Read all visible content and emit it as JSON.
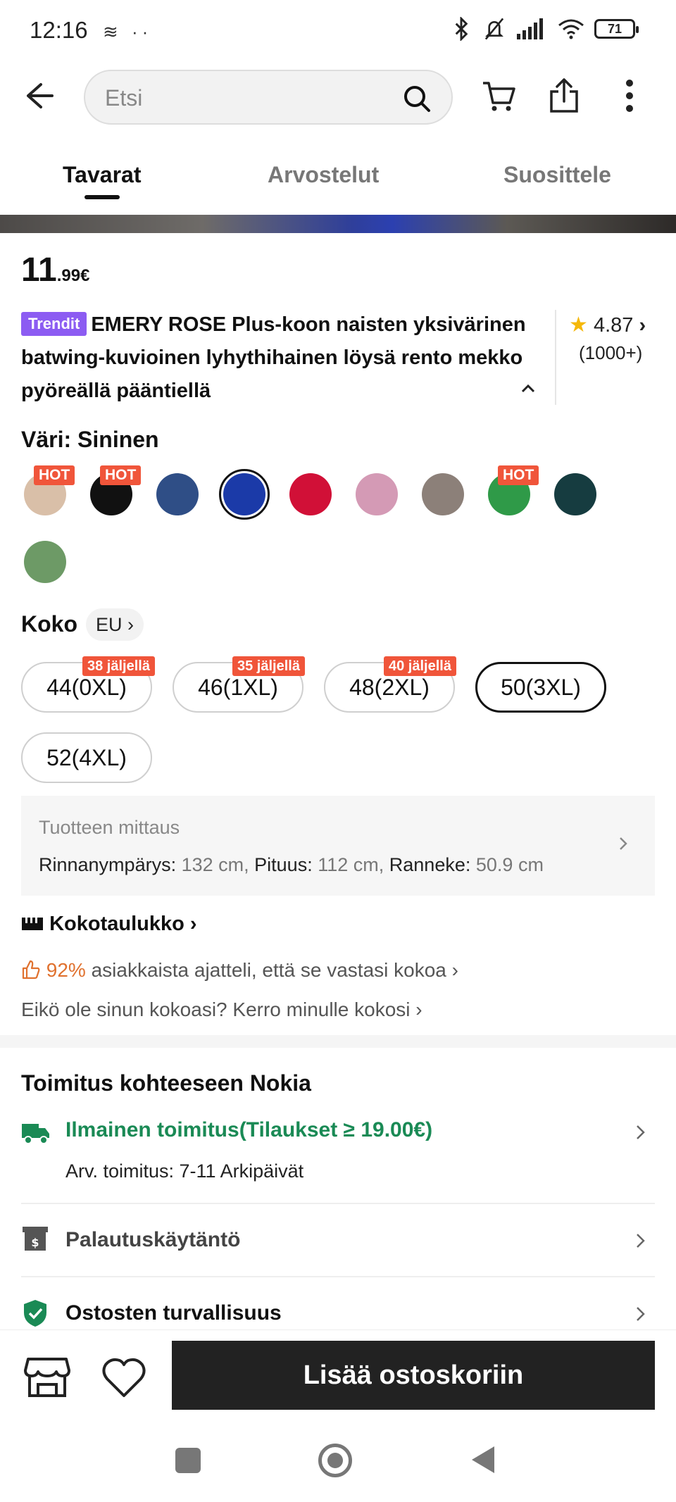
{
  "status_bar": {
    "time": "12:16",
    "left_icons": "≋ ··",
    "battery": "71"
  },
  "header": {
    "search_placeholder": "Etsi"
  },
  "tabs": [
    {
      "label": "Tavarat",
      "active": true
    },
    {
      "label": "Arvostelut",
      "active": false
    },
    {
      "label": "Suosittele",
      "active": false
    }
  ],
  "product": {
    "price_main": "11",
    "price_decimal": ".99€",
    "trend_tag": "Trendit",
    "title": "EMERY ROSE Plus-koon naisten yksivärinen batwing-kuvioinen lyhythihainen löysä rento mekko pyöreällä pääntiellä",
    "rating": "4.87",
    "rating_count": "(1000+)"
  },
  "color": {
    "label": "Väri: Sininen",
    "hot_label": "HOT",
    "swatches": [
      {
        "name": "beige",
        "color": "#d9bfa8",
        "hot": true
      },
      {
        "name": "black",
        "color": "#111111",
        "hot": true
      },
      {
        "name": "denim-blue",
        "color": "#2f4e86",
        "hot": false
      },
      {
        "name": "royal-blue",
        "color": "#1b3aa8",
        "hot": false,
        "selected": true
      },
      {
        "name": "red",
        "color": "#d11037",
        "hot": false
      },
      {
        "name": "pink",
        "color": "#d49ab5",
        "hot": false
      },
      {
        "name": "taupe",
        "color": "#8c8079",
        "hot": false
      },
      {
        "name": "green",
        "color": "#2f9a48",
        "hot": true
      },
      {
        "name": "dark-teal",
        "color": "#163c40",
        "hot": false
      },
      {
        "name": "sage",
        "color": "#6d9a66",
        "hot": false
      }
    ]
  },
  "size": {
    "label": "Koko",
    "region": "EU",
    "options": [
      {
        "label": "44(0XL)",
        "stock": "38 jäljellä"
      },
      {
        "label": "46(1XL)",
        "stock": "35 jäljellä"
      },
      {
        "label": "48(2XL)",
        "stock": "40 jäljellä"
      },
      {
        "label": "50(3XL)",
        "stock": "",
        "selected": true
      },
      {
        "label": "52(4XL)",
        "stock": ""
      }
    ]
  },
  "measurement": {
    "title": "Tuotteen mittaus",
    "bust_label": "Rinnanympärys:",
    "bust_value": "132 cm,",
    "length_label": "Pituus:",
    "length_value": "112 cm,",
    "cuff_label": "Ranneke:",
    "cuff_value": "50.9 cm"
  },
  "size_chart_label": "Kokotaulukko",
  "fit": {
    "percent": "92%",
    "text": "asiakkaista ajatteli, että se vastasi kokoa"
  },
  "not_your_size": "Eikö ole sinun kokoasi? Kerro minulle kokosi",
  "shipping": {
    "title": "Toimitus kohteeseen Nokia",
    "free": "Ilmainen toimitus(Tilaukset ≥ 19.00€)",
    "estimate": "Arv. toimitus: 7-11 Arkipäivät",
    "return_policy": "Palautuskäytäntö",
    "security": "Ostosten turvallisuus"
  },
  "bottom": {
    "add_to_cart": "Lisää ostoskoriin"
  },
  "colors": {
    "hot": "#f0553a",
    "trend": "#8c5cf2",
    "green": "#1a8a55",
    "star": "#f5b80a"
  }
}
